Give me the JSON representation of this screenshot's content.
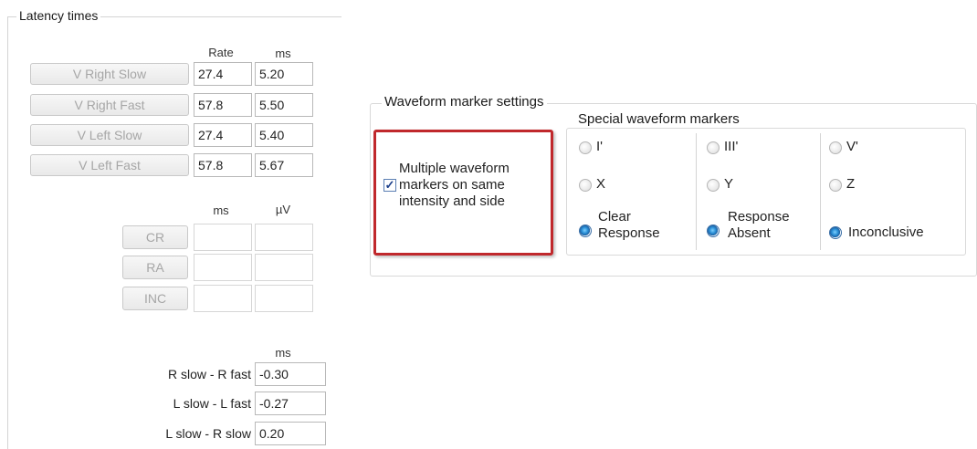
{
  "latency": {
    "title": "Latency times",
    "col_rate": "Rate",
    "col_ms": "ms",
    "rows": [
      {
        "label": "V Right Slow",
        "rate": "27.4",
        "ms": "5.20"
      },
      {
        "label": "V Right Fast",
        "rate": "57.8",
        "ms": "5.50"
      },
      {
        "label": "V Left Slow",
        "rate": "27.4",
        "ms": "5.40"
      },
      {
        "label": "V Left Fast",
        "rate": "57.8",
        "ms": "5.67"
      }
    ],
    "col_ms2": "ms",
    "col_uv": "µV",
    "markers": [
      {
        "label": "CR",
        "ms": "",
        "uv": ""
      },
      {
        "label": "RA",
        "ms": "",
        "uv": ""
      },
      {
        "label": "INC",
        "ms": "",
        "uv": ""
      }
    ],
    "col_ms3": "ms",
    "diffs": [
      {
        "label": "R slow - R fast",
        "value": "-0.30"
      },
      {
        "label": "L slow - L fast",
        "value": "-0.27"
      },
      {
        "label": "L slow - R slow",
        "value": "0.20"
      }
    ]
  },
  "waveform": {
    "title": "Waveform marker settings",
    "multiple_label": "Multiple waveform markers on same intensity and side",
    "multiple_checked": true,
    "special_title": "Special waveform markers",
    "radios": [
      {
        "label": "I'",
        "selected": false
      },
      {
        "label": "III'",
        "selected": false
      },
      {
        "label": "V'",
        "selected": false
      },
      {
        "label": "X",
        "selected": false
      },
      {
        "label": "Y",
        "selected": false
      },
      {
        "label": "Z",
        "selected": false
      },
      {
        "label": "Clear Response",
        "selected": true
      },
      {
        "label": "Response Absent",
        "selected": true
      },
      {
        "label": "Inconclusive",
        "selected": true
      }
    ]
  }
}
